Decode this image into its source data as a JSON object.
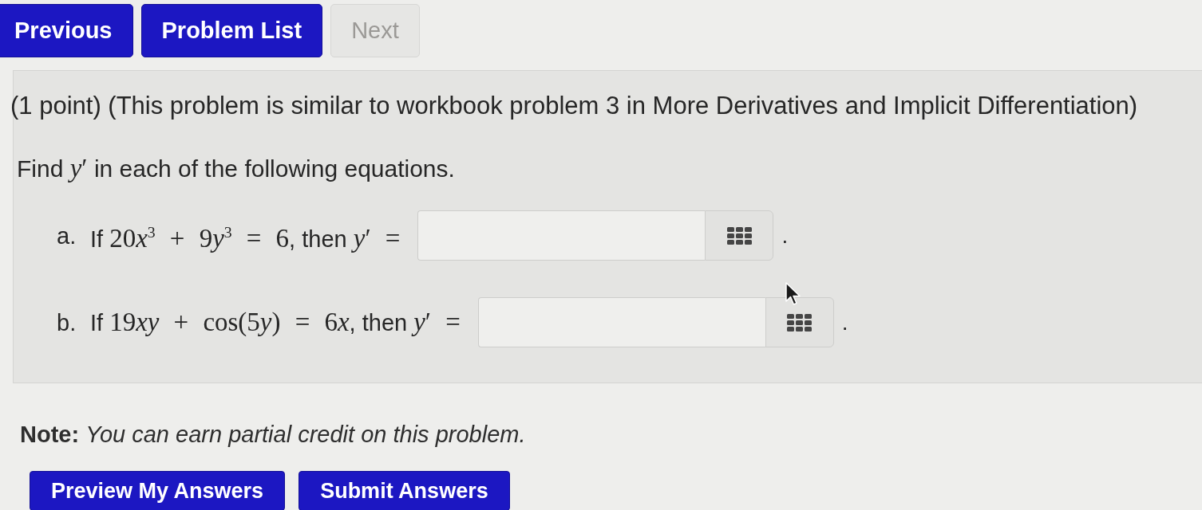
{
  "nav_buttons": [
    {
      "label": "Previous",
      "disabled": false
    },
    {
      "label": "Problem List",
      "disabled": false
    },
    {
      "label": "Next",
      "disabled": true
    }
  ],
  "problem": {
    "header": "(1 point) (This problem is similar to workbook problem 3 in More Derivatives and Implicit Differentiation)",
    "instruction": [
      {
        "kind": "text",
        "content": "Find "
      },
      {
        "kind": "var",
        "content": "y"
      },
      {
        "kind": "math",
        "content": "′"
      },
      {
        "kind": "text",
        "content": " in each of the following equations."
      }
    ],
    "parts": [
      {
        "label": "a.",
        "question": [
          {
            "kind": "text",
            "content": "If "
          },
          {
            "kind": "math",
            "content": "20"
          },
          {
            "kind": "var",
            "content": "x"
          },
          {
            "kind": "math",
            "content": "$^{3}$ + 9"
          },
          {
            "kind": "var",
            "content": "y"
          },
          {
            "kind": "math",
            "content": "$^{3}$ = 6"
          },
          {
            "kind": "text",
            "content": ", then "
          },
          {
            "kind": "var",
            "content": "y"
          },
          {
            "kind": "math",
            "content": "′ ="
          }
        ],
        "end_mark": "."
      },
      {
        "label": "b.",
        "question": [
          {
            "kind": "text",
            "content": "If "
          },
          {
            "kind": "math",
            "content": "19"
          },
          {
            "kind": "var",
            "content": "xy"
          },
          {
            "kind": "math",
            "content": " + cos(5"
          },
          {
            "kind": "var",
            "content": "y"
          },
          {
            "kind": "math",
            "content": ") = 6"
          },
          {
            "kind": "var",
            "content": "x"
          },
          {
            "kind": "text",
            "content": ", then "
          },
          {
            "kind": "var",
            "content": "y"
          },
          {
            "kind": "math",
            "content": "′ ="
          }
        ],
        "end_mark": "."
      }
    ]
  },
  "note": "**Note:** *You can earn partial credit on this problem.*",
  "action_buttons": [
    "Preview My Answers",
    "Submit Answers"
  ]
}
